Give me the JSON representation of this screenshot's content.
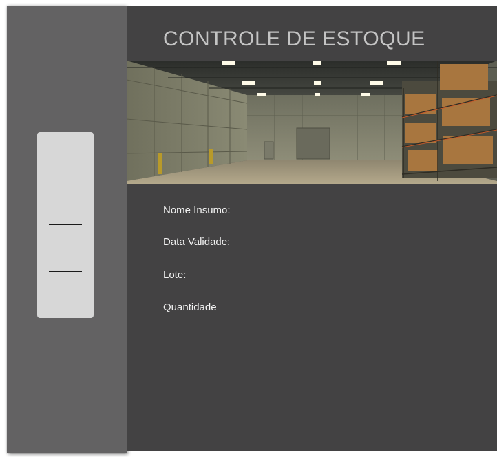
{
  "header": {
    "title": "CONTROLE DE ESTOQUE"
  },
  "banner": {
    "image": "warehouse-interior-photo"
  },
  "form": {
    "labels": {
      "nome_insumo": "Nome Insumo:",
      "data_validade": "Data Validade:",
      "lote": "Lote:",
      "quantidade": "Quantidade"
    }
  },
  "sidebar": {
    "menu_items": [
      "",
      "",
      ""
    ]
  },
  "colors": {
    "sidebar_bg": "#636263",
    "main_bg": "#434243",
    "menu_card_bg": "#d7d7d7",
    "title_color": "#c4c4c4",
    "label_color": "#f2f2f2"
  }
}
